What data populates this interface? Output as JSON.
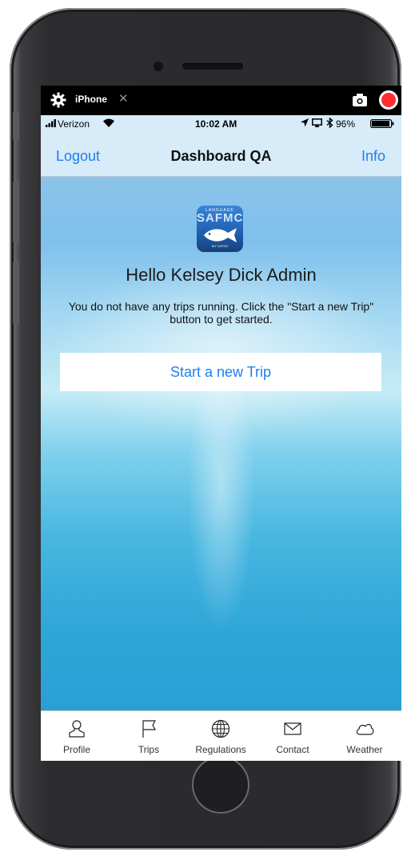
{
  "extension_bar": {
    "label": "iPhone",
    "close_glyph": "✕",
    "icons": [
      "gear-icon",
      "close-icon",
      "camera-icon",
      "record-icon"
    ]
  },
  "status_bar": {
    "carrier": "Verizon",
    "time": "10:02 AM",
    "battery": "96%",
    "battery_level": 0.96
  },
  "nav_bar": {
    "left": "Logout",
    "title": "Dashboard QA",
    "right": "Info"
  },
  "logo": {
    "top": "LANGUAGE",
    "main": "SAFMC",
    "bottom": "MY CATCH"
  },
  "content": {
    "greeting": "Hello Kelsey Dick Admin",
    "message": "You do not have any trips running. Click the \"Start a new Trip\" button to get started.",
    "start_button": "Start a new Trip"
  },
  "tabs": [
    {
      "label": "Profile",
      "icon": "person-icon"
    },
    {
      "label": "Trips",
      "icon": "flag-icon"
    },
    {
      "label": "Regulations",
      "icon": "globe-icon"
    },
    {
      "label": "Contact",
      "icon": "envelope-icon"
    },
    {
      "label": "Weather",
      "icon": "cloud-icon"
    }
  ],
  "colors": {
    "accent": "#1e7ff0",
    "nav_bg": "#d7ebf8",
    "record": "#ff2d2d"
  }
}
